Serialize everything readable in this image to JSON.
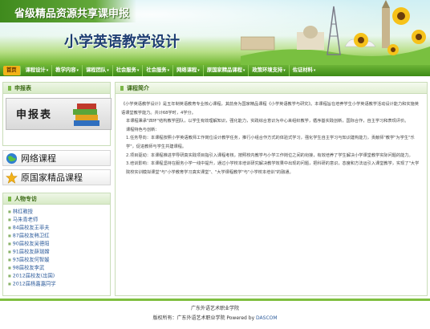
{
  "header": {
    "site_name": "省级精品资源共享课申报",
    "course_title": "小学英语教学设计"
  },
  "nav": {
    "items": [
      {
        "label": "首页",
        "active": true
      },
      {
        "label": "课程设计",
        "caret": "▾"
      },
      {
        "label": "教学内容",
        "caret": "▾"
      },
      {
        "label": "课程团队",
        "caret": "▾"
      },
      {
        "label": "社会服务",
        "caret": "▾"
      },
      {
        "label": "社会服务",
        "caret": "▾"
      },
      {
        "label": "网络课程",
        "caret": "▾"
      },
      {
        "label": "原国家精品课程",
        "caret": "▾"
      },
      {
        "label": "政策环境支持",
        "caret": "▾"
      },
      {
        "label": "佐证材料",
        "caret": "▾"
      }
    ]
  },
  "sidebar": {
    "apply_box": {
      "title": "申报表",
      "image_text": "申报表"
    },
    "links": [
      {
        "label": "网络课程",
        "icon": "globe-icon"
      },
      {
        "label": "原国家精品课程",
        "icon": "star-icon"
      }
    ],
    "alpha_box": {
      "title": "人物专访",
      "items": [
        "林红教授",
        "马朱青老师",
        "84届校友王菲夫",
        "87届校友韩卫红",
        "90届校友吴德阳",
        "91届校友薛瑞嫦",
        "93届校友何智媛",
        "98届校友李武",
        "2012届校友(出国)",
        "2012届杨嘉嘉同学"
      ]
    }
  },
  "main": {
    "title": "课程简介",
    "paragraphs": [
      "《小学英语教学设计》是五年制英语教育专业核心课程，其前身为国家精品课程《小学英语教学与研究》。本课程旨在培养学生小学英语教学活动设计能力和实施英语课堂教学能力。共计68学时，4学分。",
      "本课程秉承\"四环\"结构教学团队，以学生有效理解知识，强化能力，实践综合意识为中心来组织教学，循序基实践创新，国际合作，自主学习和表现评价。",
      "课程特色与创新：",
      "1.任务导向：本课程按照小学英语教师工作岗位设计教学任务，推行小组合作方式的体验式学习，强化学生自主学习与知识建构能力，贡献师\"教学\"为学生\"乐学\"，促进教师与学生共建课程。",
      "2.项目驱动：本课程推进学导研真实践项目指引入课程考核，按照校内教学与小学工作岗位之间的衔接，有效培养了学生解决小学课堂教学实际问题的能力。",
      "3.培训影响：本课程坚持在服务小学一线中提升，通过小学校本培训研究解决教学效果中出现的问题，把科研的意识，态度和方法运引入课堂教学，实现了\"大学院校实训模拟课堂\"与\"小学教育学习真实课堂\"、\"大学课程教学\"与\"小学校本培训\"的融通。"
    ]
  },
  "footer": {
    "line1": "广东外语艺术职业学院",
    "line2_prefix": "版权所有：广东外语艺术职业学院 Powered by ",
    "line2_powered": "DASCOM"
  },
  "colors": {
    "nav_green": "#3c8a16",
    "active_orange": "#f2b318",
    "link_blue": "#2f5d9c",
    "course_title": "#1f3f73"
  }
}
